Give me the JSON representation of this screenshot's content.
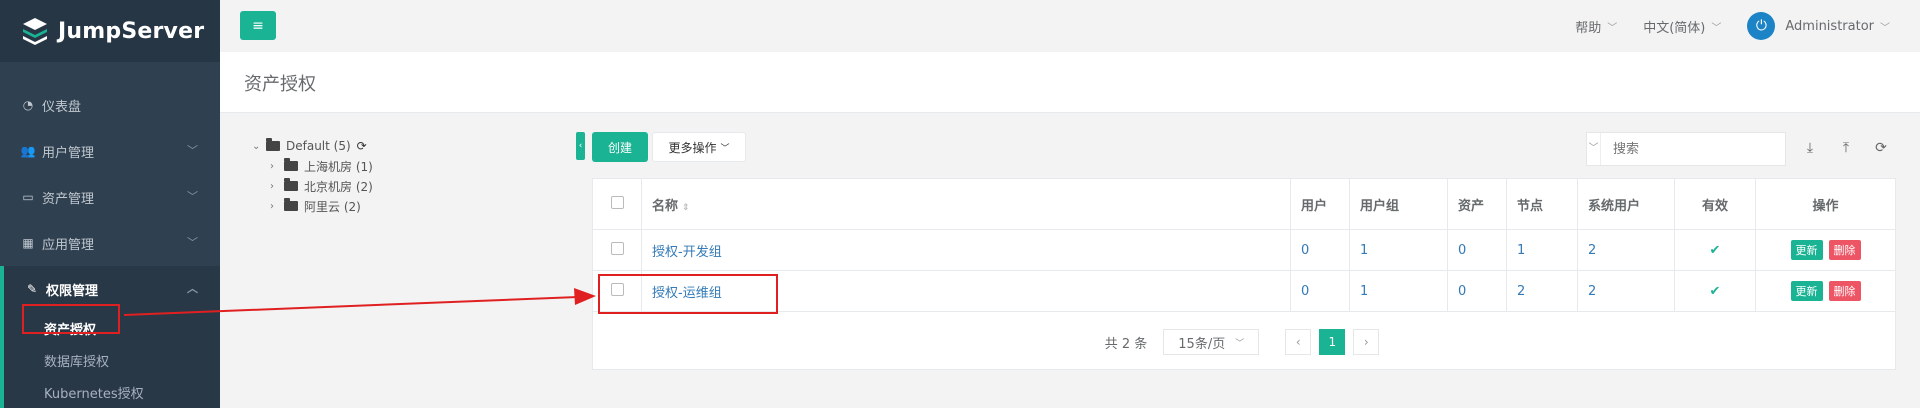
{
  "app": {
    "logo_text": "JumpServer"
  },
  "sidebar": {
    "items": [
      {
        "label": "仪表盘",
        "icon": "dashboard-icon"
      },
      {
        "label": "用户管理",
        "icon": "users-icon"
      },
      {
        "label": "资产管理",
        "icon": "inbox-icon"
      },
      {
        "label": "应用管理",
        "icon": "grid-icon"
      },
      {
        "label": "权限管理",
        "icon": "edit-icon"
      }
    ],
    "sub_items": [
      {
        "label": "资产授权"
      },
      {
        "label": "数据库授权"
      },
      {
        "label": "Kubernetes授权"
      }
    ]
  },
  "topbar": {
    "help": "帮助",
    "language": "中文(简体)",
    "user": "Administrator"
  },
  "page": {
    "title": "资产授权"
  },
  "tree": {
    "root": "Default (5)",
    "children": [
      "上海机房 (1)",
      "北京机房 (2)",
      "阿里云 (2)"
    ]
  },
  "toolbar": {
    "create": "创建",
    "more": "更多操作",
    "search_placeholder": "搜索"
  },
  "table": {
    "headers": [
      "名称",
      "用户",
      "用户组",
      "资产",
      "节点",
      "系统用户",
      "有效",
      "操作"
    ],
    "rows": [
      {
        "name": "授权-开发组",
        "users": "0",
        "groups": "1",
        "assets": "0",
        "nodes": "1",
        "sysusers": "2"
      },
      {
        "name": "授权-运维组",
        "users": "0",
        "groups": "1",
        "assets": "0",
        "nodes": "2",
        "sysusers": "2"
      }
    ],
    "update": "更新",
    "delete": "删除"
  },
  "pager": {
    "total": "共 2 条",
    "page_size": "15条/页",
    "current": "1"
  },
  "colors": {
    "accent": "#1ab394",
    "danger": "#ed5565",
    "sidebar": "#2f4050",
    "annotation": "#e02020"
  }
}
